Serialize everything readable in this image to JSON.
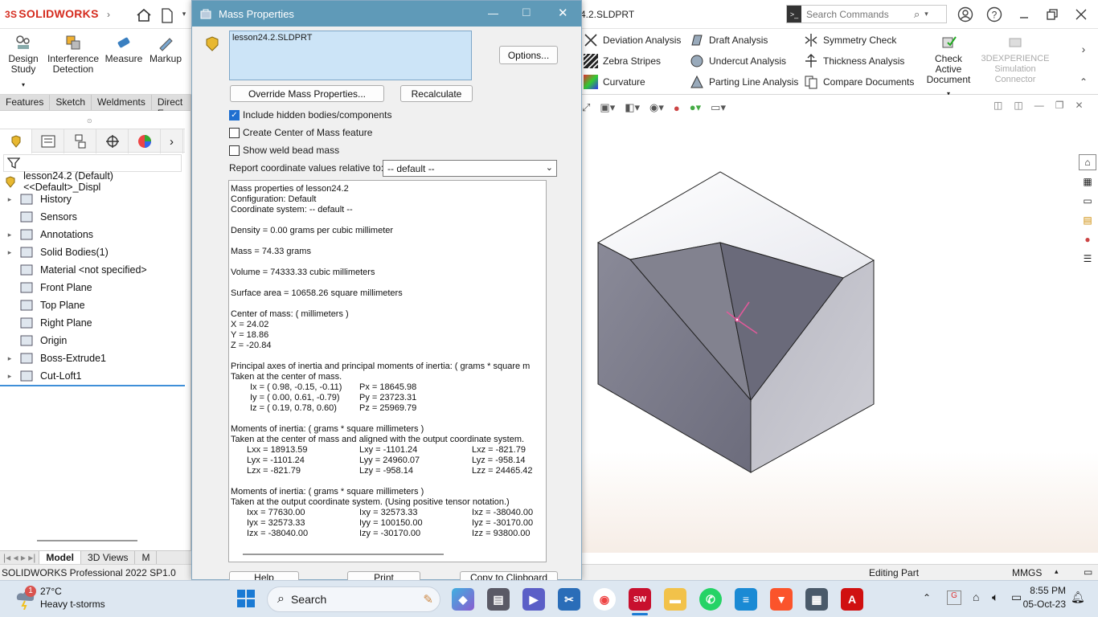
{
  "app": {
    "brand": "SOLIDWORKS",
    "doc_title": "4.2.SLDPRT",
    "search_placeholder": "Search Commands"
  },
  "command_manager": {
    "big_left": [
      {
        "l1": "Design",
        "l2": "Study"
      },
      {
        "l1": "Interference",
        "l2": "Detection"
      },
      {
        "l1": "Measure",
        "l2": ""
      },
      {
        "l1": "Markup",
        "l2": ""
      }
    ],
    "col1": [
      "Deviation Analysis",
      "Zebra Stripes",
      "Curvature"
    ],
    "col2": [
      "Draft Analysis",
      "Undercut Analysis",
      "Parting Line Analysis"
    ],
    "col3": [
      "Symmetry Check",
      "Thickness Analysis",
      "Compare Documents"
    ],
    "check_active": {
      "l1": "Check Active",
      "l2": "Document"
    },
    "threedx": {
      "l1": "3DEXPERIENCE",
      "l2": "Simulation",
      "l3": "Connector"
    }
  },
  "tabs": [
    "Features",
    "Sketch",
    "Weldments",
    "Direct E"
  ],
  "tree": {
    "root": "lesson24.2 (Default) <<Default>_Displ",
    "items": [
      {
        "label": "History",
        "exp": true,
        "icon": "history-icon"
      },
      {
        "label": "Sensors",
        "exp": false,
        "icon": "sensors-icon"
      },
      {
        "label": "Annotations",
        "exp": true,
        "icon": "annotations-icon"
      },
      {
        "label": "Solid Bodies(1)",
        "exp": true,
        "icon": "solid-bodies-icon"
      },
      {
        "label": "Material <not specified>",
        "exp": false,
        "icon": "material-icon"
      },
      {
        "label": "Front Plane",
        "exp": false,
        "icon": "plane-icon"
      },
      {
        "label": "Top Plane",
        "exp": false,
        "icon": "plane-icon"
      },
      {
        "label": "Right Plane",
        "exp": false,
        "icon": "plane-icon"
      },
      {
        "label": "Origin",
        "exp": false,
        "icon": "origin-icon"
      },
      {
        "label": "Boss-Extrude1",
        "exp": true,
        "icon": "extrude-icon"
      },
      {
        "label": "Cut-Loft1",
        "exp": true,
        "icon": "cut-loft-icon"
      }
    ]
  },
  "bottom_tabs": [
    "Model",
    "3D Views",
    "M"
  ],
  "status": {
    "left": "SOLIDWORKS Professional 2022 SP1.0",
    "mid": "Editing Part",
    "units": "MMGS"
  },
  "dialog": {
    "title": "Mass Properties",
    "selection": "lesson24.2.SLDPRT",
    "options_btn": "Options...",
    "override_btn": "Override Mass Properties...",
    "recalc_btn": "Recalculate",
    "cb_hidden": "Include hidden bodies/components",
    "cb_hidden_checked": true,
    "cb_com": "Create Center of Mass feature",
    "cb_weld": "Show weld bead mass",
    "report_label": "Report coordinate values relative to:",
    "report_value": "-- default --",
    "bottom_buttons": [
      "Help",
      "Print",
      "Copy to Clipboard"
    ],
    "lines": [
      "Mass properties of lesson24.2",
      "     Configuration: Default",
      "     Coordinate system: -- default --",
      "",
      "Density = 0.00 grams per cubic millimeter",
      "",
      "Mass = 74.33 grams",
      "",
      "Volume = 74333.33 cubic millimeters",
      "",
      "Surface area = 10658.26  square millimeters",
      "",
      "Center of mass: ( millimeters )",
      "        X = 24.02",
      "        Y = 18.86",
      "        Z = -20.84",
      "",
      "Principal axes of inertia and principal moments of inertia: ( grams *  square m",
      "Taken at the center of mass."
    ],
    "principal": [
      [
        "Ix = ( 0.98, -0.15, -0.11)",
        "Px = 18645.98"
      ],
      [
        "Iy = ( 0.00,  0.61, -0.79)",
        "Py = 23723.31"
      ],
      [
        "Iz = ( 0.19,  0.78,  0.60)",
        "Pz = 25969.79"
      ]
    ],
    "moi_cm_title": "Moments of inertia: ( grams *  square millimeters )",
    "moi_cm_sub": "Taken at the center of mass and aligned with the output coordinate system.",
    "moi_cm": [
      [
        "Lxx = 18913.59",
        "Lxy = -1101.24",
        "Lxz = -821.79"
      ],
      [
        "Lyx = -1101.24",
        "Lyy = 24960.07",
        "Lyz = -958.14"
      ],
      [
        "Lzx = -821.79",
        "Lzy = -958.14",
        "Lzz = 24465.42"
      ]
    ],
    "moi_out_title": "Moments of inertia: ( grams *  square millimeters )",
    "moi_out_sub": "Taken at the output coordinate system. (Using positive tensor notation.)",
    "moi_out": [
      [
        "Ixx = 77630.00",
        "Ixy = 32573.33",
        "Ixz = -38040.00"
      ],
      [
        "Iyx = 32573.33",
        "Iyy = 100150.00",
        "Iyz = -30170.00"
      ],
      [
        "Izx = -38040.00",
        "Izy = -30170.00",
        "Izz = 93800.00"
      ]
    ]
  },
  "taskbar": {
    "weather_temp": "27°C",
    "weather_desc": "Heavy t-storms",
    "weather_badge": "1",
    "search": "Search",
    "time": "8:55 PM",
    "date": "05-Oct-23"
  }
}
